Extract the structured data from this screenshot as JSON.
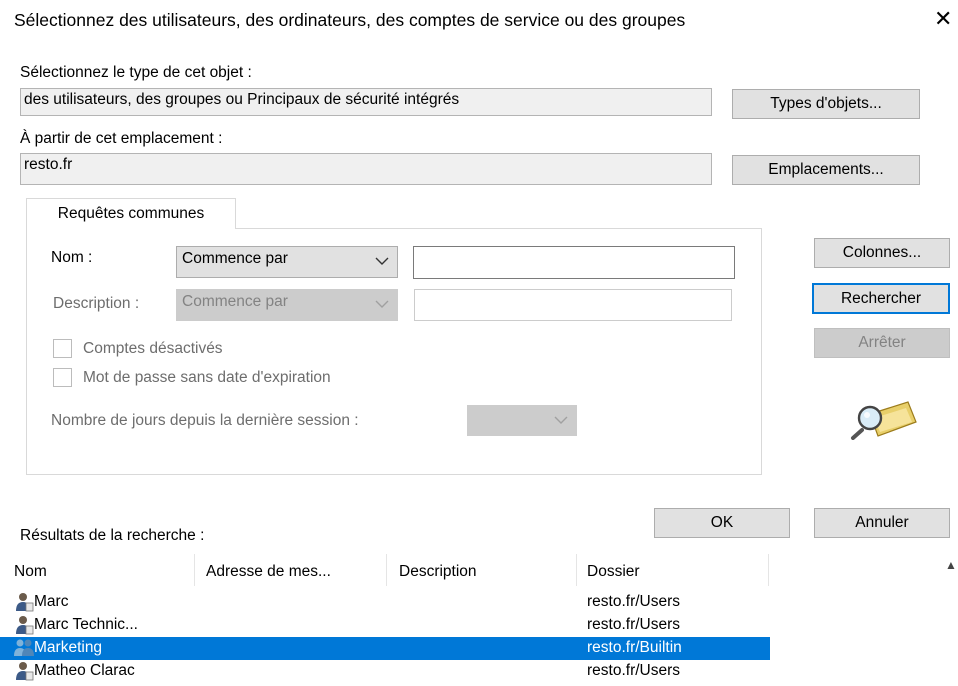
{
  "dialog": {
    "title": "Sélectionnez des utilisateurs, des ordinateurs, des comptes de service ou des groupes",
    "close_glyph": "✕"
  },
  "object_type": {
    "label": "Sélectionnez le type de cet objet :",
    "value": "des utilisateurs, des groupes ou Principaux de sécurité intégrés",
    "button": "Types d'objets..."
  },
  "location": {
    "label": "À partir de cet emplacement :",
    "value": "resto.fr",
    "button": "Emplacements..."
  },
  "query": {
    "tab_label": "Requêtes communes",
    "name_label": "Nom :",
    "name_mode": "Commence par",
    "name_value": "",
    "description_label": "Description :",
    "description_mode": "Commence par",
    "description_value": "",
    "disabled_accounts_label": "Comptes désactivés",
    "disabled_accounts_checked": false,
    "no_expiry_label": "Mot de passe sans date d'expiration",
    "no_expiry_checked": false,
    "days_since_label": "Nombre de jours depuis la dernière session :",
    "days_since_value": ""
  },
  "side_buttons": {
    "columns": "Colonnes...",
    "search": "Rechercher",
    "stop": "Arrêter"
  },
  "footer_buttons": {
    "ok": "OK",
    "cancel": "Annuler"
  },
  "results": {
    "label": "Résultats de la recherche :",
    "columns": [
      "Nom",
      "Adresse de mes...",
      "Description",
      "Dossier"
    ],
    "rows": [
      {
        "name": "Marc",
        "email": "",
        "description": "",
        "folder": "resto.fr/Users",
        "icon": "user-icon",
        "selected": false
      },
      {
        "name": "Marc Technic...",
        "email": "",
        "description": "",
        "folder": "resto.fr/Users",
        "icon": "user-icon",
        "selected": false
      },
      {
        "name": "Marketing",
        "email": "",
        "description": "",
        "folder": "resto.fr/Builtin",
        "icon": "group-icon",
        "selected": true
      },
      {
        "name": "Matheo Clarac",
        "email": "",
        "description": "",
        "folder": "resto.fr/Users",
        "icon": "user-icon",
        "selected": false
      }
    ]
  },
  "icons": {
    "search_graphic": "magnifier-folder-icon",
    "chevron": "chevron-down-icon"
  },
  "colors": {
    "selection": "#0078d7",
    "button_face": "#e1e1e1",
    "readonly_field": "#f0f0f0"
  }
}
